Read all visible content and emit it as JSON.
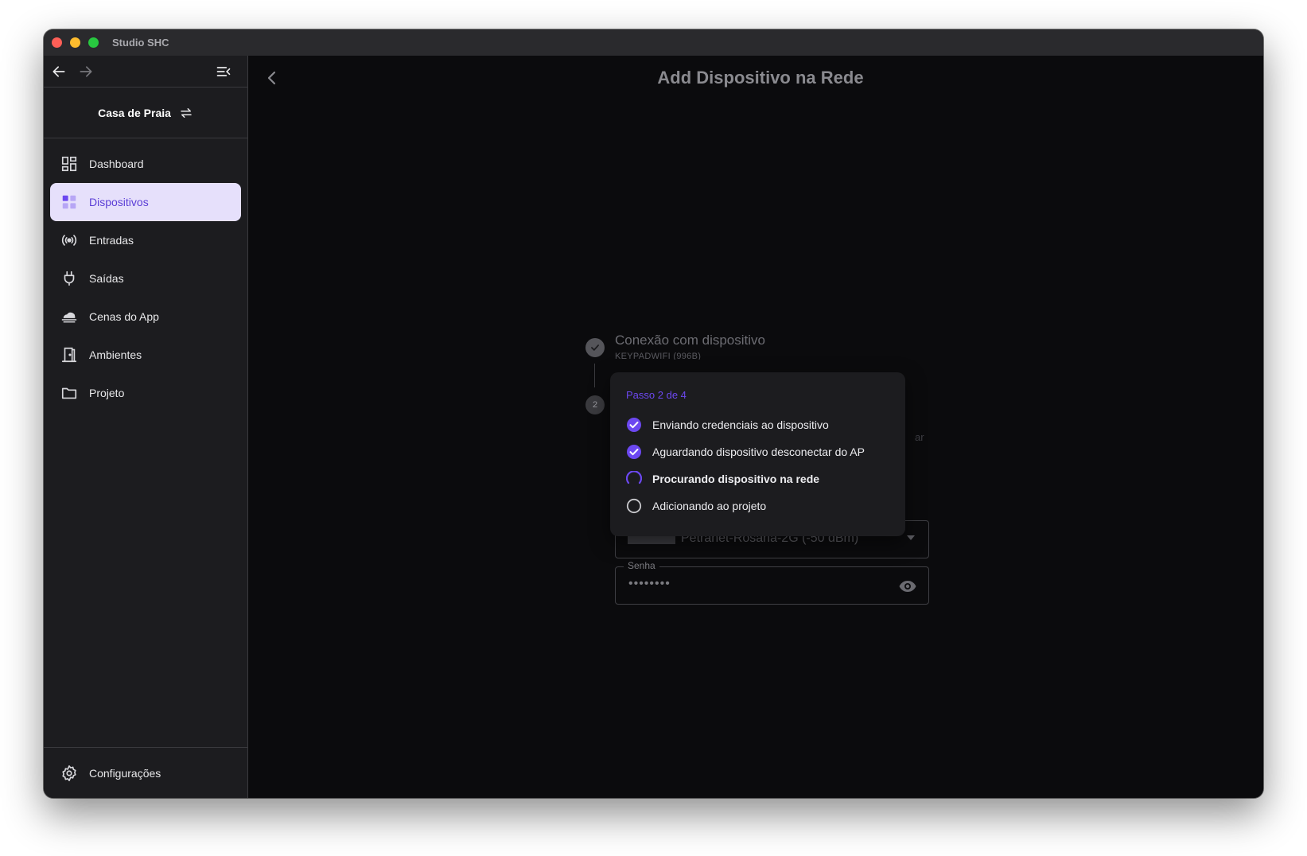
{
  "window": {
    "title": "Studio SHC"
  },
  "sidebar": {
    "project": "Casa de Praia",
    "items": [
      {
        "label": "Dashboard",
        "icon": "dashboard-icon",
        "active": false
      },
      {
        "label": "Dispositivos",
        "icon": "devices-icon",
        "active": true
      },
      {
        "label": "Entradas",
        "icon": "broadcast-icon",
        "active": false
      },
      {
        "label": "Saídas",
        "icon": "plug-icon",
        "active": false
      },
      {
        "label": "Cenas do App",
        "icon": "cloud-scene-icon",
        "active": false
      },
      {
        "label": "Ambientes",
        "icon": "door-icon",
        "active": false
      },
      {
        "label": "Projeto",
        "icon": "folder-icon",
        "active": false
      }
    ],
    "settings_label": "Configurações"
  },
  "main": {
    "title": "Add Dispositivo na Rede",
    "step1": {
      "title": "Conexão com dispositivo",
      "subtitle": "KEYPADWIFI (996B)"
    },
    "step2_number": "2",
    "ghost_text": "ar",
    "wifi_network": "Petranet-Rosana-2G (-50 dBm)",
    "password_label": "Senha",
    "password_value": "••••••••"
  },
  "progress_popup": {
    "step_label": "Passo 2 de 4",
    "tasks": [
      {
        "label": "Enviando credenciais ao dispositivo",
        "status": "done"
      },
      {
        "label": "Aguardando dispositivo desconectar do AP",
        "status": "done"
      },
      {
        "label": "Procurando dispositivo na rede",
        "status": "in-progress"
      },
      {
        "label": "Adicionando ao projeto",
        "status": "pending"
      }
    ]
  },
  "colors": {
    "accent": "#6c48f0",
    "active_item_bg": "#e6e0fb",
    "sidebar_bg": "#1c1c1f",
    "main_bg": "#0b0b0d"
  }
}
